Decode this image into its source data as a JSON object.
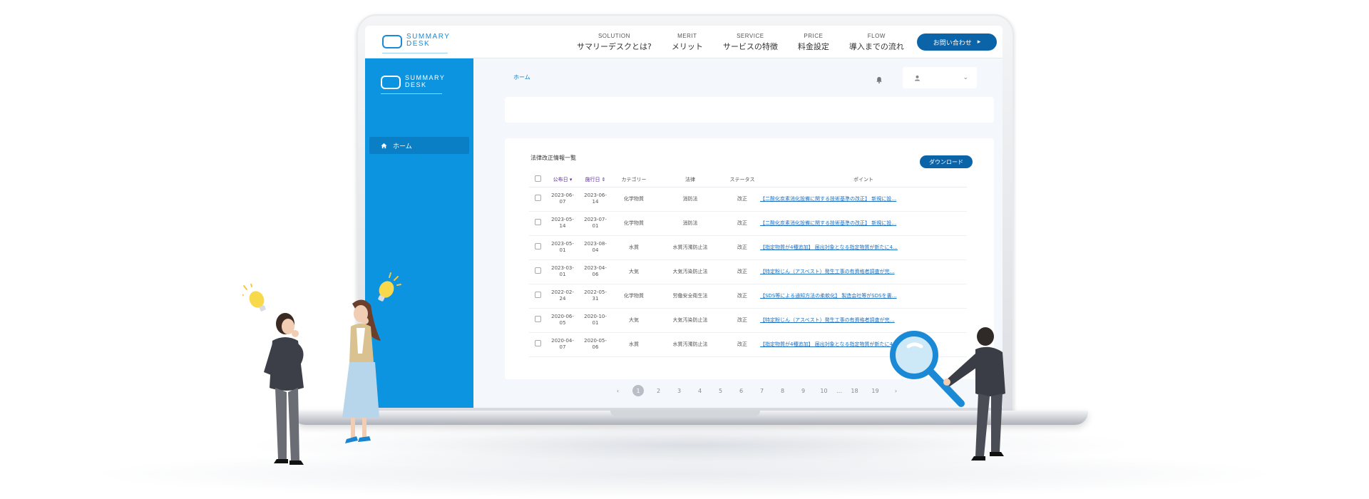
{
  "topnav": {
    "logo": [
      "SUMMARY",
      "DESK"
    ],
    "items": [
      {
        "en": "SOLUTION",
        "ja": "サマリーデスクとは?"
      },
      {
        "en": "MERIT",
        "ja": "メリット"
      },
      {
        "en": "SERVICE",
        "ja": "サービスの特徴"
      },
      {
        "en": "PRICE",
        "ja": "料金設定"
      },
      {
        "en": "FLOW",
        "ja": "導入までの流れ"
      }
    ],
    "contact_label": "お問い合わせ",
    "contact_arrow": "▸"
  },
  "sidebar": {
    "logo": [
      "SUMMARY",
      "DESK"
    ],
    "home_label": "ホーム"
  },
  "main": {
    "breadcrumb": "ホーム",
    "user_chevron": "⌄",
    "table_title": "法律改正情報一覧",
    "download_label": "ダウンロード",
    "columns": [
      "公布日 ▾",
      "施行日 ⇕",
      "カテゴリー",
      "法律",
      "ステータス",
      "ポイント"
    ],
    "rows": [
      {
        "pub": [
          "2023-06-",
          "07"
        ],
        "eff": [
          "2023-06-",
          "14"
        ],
        "category": "化学物質",
        "law": "消防法",
        "status": "改正",
        "point": "【二酸化炭素消化設備に関する技術基準の改正】 新規に設…"
      },
      {
        "pub": [
          "2023-05-",
          "14"
        ],
        "eff": [
          "2023-07-",
          "01"
        ],
        "category": "化学物質",
        "law": "消防法",
        "status": "改正",
        "point": "【二酸化炭素消化設備に関する技術基準の改正】 新規に設…"
      },
      {
        "pub": [
          "2023-05-",
          "01"
        ],
        "eff": [
          "2023-08-",
          "04"
        ],
        "category": "水質",
        "law": "水質汚濁防止法",
        "status": "改正",
        "point": "【指定物質が4種追加】 届出対象となる指定物質が新たに4…"
      },
      {
        "pub": [
          "2023-03-",
          "01"
        ],
        "eff": [
          "2023-04-",
          "06"
        ],
        "category": "大気",
        "law": "大気汚染防止法",
        "status": "改正",
        "point": "【特定粉じん（アスベスト）発生工事の有資格者調査が完…"
      },
      {
        "pub": [
          "2022-02-",
          "24"
        ],
        "eff": [
          "2022-05-",
          "31"
        ],
        "category": "化学物質",
        "law": "労働安全衛生法",
        "status": "改正",
        "point": "【SDS等による通知方法の柔軟化】 製造会社等がSDSを書…"
      },
      {
        "pub": [
          "2020-06-",
          "05"
        ],
        "eff": [
          "2020-10-",
          "01"
        ],
        "category": "大気",
        "law": "大気汚染防止法",
        "status": "改正",
        "point": "【特定粉じん（アスベスト）発生工事の有資格者調査が完…"
      },
      {
        "pub": [
          "2020-04-",
          "07"
        ],
        "eff": [
          "2020-05-",
          "06"
        ],
        "category": "水質",
        "law": "水質汚濁防止法",
        "status": "改正",
        "point": "【指定物質が4種追加】 届出対象となる指定物質が新たに4…"
      }
    ],
    "pager": {
      "prev": "‹",
      "pages": [
        "1",
        "2",
        "3",
        "4",
        "5",
        "6",
        "7",
        "8",
        "9",
        "10"
      ],
      "ellipsis": "…",
      "tail": [
        "18",
        "19"
      ],
      "next": "›",
      "current": "1"
    }
  },
  "colors": {
    "sidebar": "#0d94e0",
    "primary_button": "#0b63a8",
    "link": "#1a6fc0",
    "sort_header": "#5b2fa0"
  }
}
